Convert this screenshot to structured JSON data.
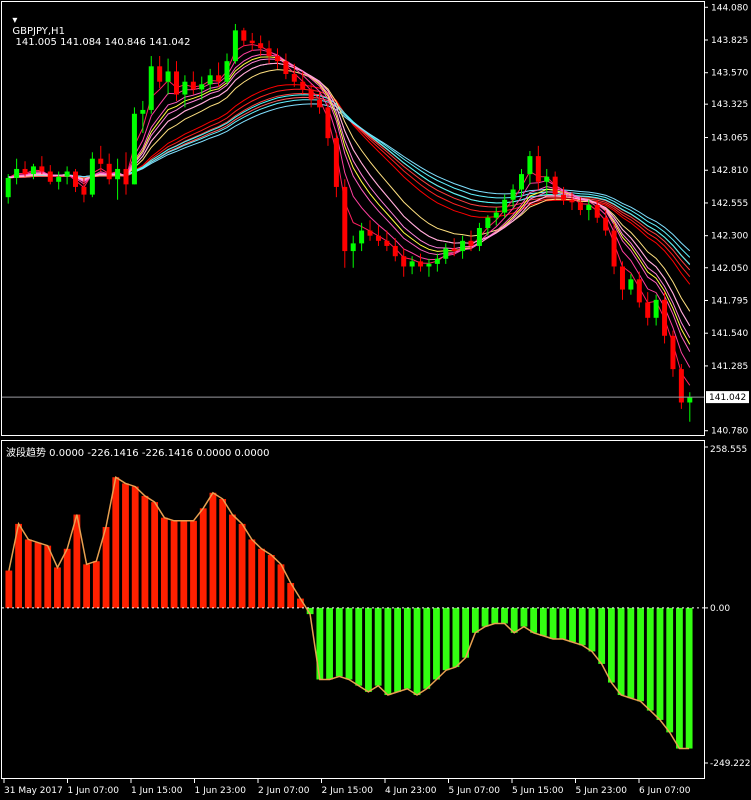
{
  "window": {
    "symbol_header": "GBPJPY,H1",
    "ohlc_values": [
      "141.005",
      "141.084",
      "140.846",
      "141.042"
    ],
    "indicator_header": "波段趋势 0.0000 -226.1416 -226.1416 0.0000 0.0000"
  },
  "colors": {
    "background": "#000000",
    "frame": "#ffffff",
    "bull_candle": "#00ff00",
    "bear_candle": "#ff0000",
    "hist_positive": "#ff2000",
    "hist_negative": "#33ff11",
    "hist_outline": "#e8a050",
    "ribbon_fast": [
      "#ff2060",
      "#ff40a0",
      "#ff60c0",
      "#ff80d8",
      "#ffa0e8"
    ],
    "ribbon_mid": [
      "#ffff40",
      "#ffef60",
      "#ffe080"
    ],
    "ribbon_slow_top": [
      "#40ffff",
      "#60f0ff",
      "#80e0ff"
    ],
    "ribbon_slow_bottom": [
      "#ff0000",
      "#ff2020",
      "#ff4040",
      "#ff6060"
    ]
  },
  "chart_data": [
    {
      "type": "candlestick",
      "title": "GBPJPY,H1",
      "price_axis_ticks": [
        "144.080",
        "143.825",
        "143.570",
        "143.325",
        "143.065",
        "142.810",
        "142.555",
        "142.300",
        "142.050",
        "141.795",
        "141.540",
        "141.285",
        "140.780"
      ],
      "current_price_label": "141.042",
      "ylim": [
        140.77,
        144.09
      ],
      "time_axis_labels": [
        "31 May 2017",
        "1 Jun 07:00",
        "1 Jun 15:00",
        "1 Jun 23:00",
        "2 Jun 07:00",
        "2 Jun 15:00",
        "4 Jun 23:00",
        "5 Jun 07:00",
        "5 Jun 15:00",
        "5 Jun 23:00",
        "6 Jun 07:00"
      ],
      "grid": false,
      "series": [
        {
          "values": [
            [
              142.6,
              142.78,
              142.55,
              142.75
            ],
            [
              142.75,
              142.9,
              142.7,
              142.82
            ],
            [
              142.82,
              142.88,
              142.76,
              142.78
            ],
            [
              142.78,
              142.86,
              142.74,
              142.84
            ],
            [
              142.84,
              142.92,
              142.78,
              142.8
            ],
            [
              142.8,
              142.85,
              142.7,
              142.72
            ],
            [
              142.72,
              142.8,
              142.66,
              142.76
            ],
            [
              142.76,
              142.84,
              142.7,
              142.8
            ],
            [
              142.8,
              142.82,
              142.64,
              142.68
            ],
            [
              142.68,
              142.75,
              142.56,
              142.62
            ],
            [
              142.62,
              142.95,
              142.6,
              142.9
            ],
            [
              142.9,
              143.0,
              142.8,
              142.86
            ],
            [
              142.86,
              142.94,
              142.7,
              142.74
            ],
            [
              142.74,
              142.9,
              142.58,
              142.82
            ],
            [
              142.82,
              142.95,
              142.62,
              142.7
            ],
            [
              142.7,
              143.3,
              142.7,
              143.25
            ],
            [
              143.25,
              143.35,
              143.1,
              143.28
            ],
            [
              143.28,
              143.7,
              143.25,
              143.62
            ],
            [
              143.62,
              143.7,
              143.45,
              143.5
            ],
            [
              143.5,
              143.68,
              143.4,
              143.58
            ],
            [
              143.58,
              143.66,
              143.35,
              143.4
            ],
            [
              143.4,
              143.55,
              143.3,
              143.5
            ],
            [
              143.5,
              143.58,
              143.4,
              143.44
            ],
            [
              143.44,
              143.54,
              143.36,
              143.48
            ],
            [
              143.48,
              143.6,
              143.42,
              143.55
            ],
            [
              143.55,
              143.65,
              143.46,
              143.5
            ],
            [
              143.5,
              143.72,
              143.48,
              143.66
            ],
            [
              143.66,
              143.95,
              143.64,
              143.9
            ],
            [
              143.9,
              143.92,
              143.78,
              143.82
            ],
            [
              143.82,
              143.88,
              143.74,
              143.8
            ],
            [
              143.8,
              143.86,
              143.7,
              143.76
            ],
            [
              143.76,
              143.82,
              143.64,
              143.7
            ],
            [
              143.7,
              143.76,
              143.6,
              143.66
            ],
            [
              143.66,
              143.72,
              143.52,
              143.56
            ],
            [
              143.56,
              143.64,
              143.46,
              143.5
            ],
            [
              143.5,
              143.58,
              143.4,
              143.44
            ],
            [
              143.44,
              143.48,
              143.3,
              143.36
            ],
            [
              143.36,
              143.42,
              143.25,
              143.3
            ],
            [
              143.3,
              143.34,
              143.0,
              143.06
            ],
            [
              143.06,
              143.1,
              142.6,
              142.68
            ],
            [
              142.68,
              142.74,
              142.05,
              142.18
            ],
            [
              142.18,
              142.3,
              142.05,
              142.24
            ],
            [
              142.24,
              142.4,
              142.18,
              142.34
            ],
            [
              142.34,
              142.42,
              142.26,
              142.3
            ],
            [
              142.3,
              142.38,
              142.22,
              142.26
            ],
            [
              142.26,
              142.34,
              142.18,
              142.22
            ],
            [
              142.22,
              142.28,
              142.1,
              142.14
            ],
            [
              142.14,
              142.2,
              141.98,
              142.06
            ],
            [
              142.06,
              142.14,
              142.0,
              142.1
            ],
            [
              142.1,
              142.16,
              142.02,
              142.06
            ],
            [
              142.06,
              142.12,
              141.98,
              142.08
            ],
            [
              142.08,
              142.16,
              142.02,
              142.12
            ],
            [
              142.12,
              142.24,
              142.08,
              142.2
            ],
            [
              142.2,
              142.28,
              142.14,
              142.18
            ],
            [
              142.18,
              142.3,
              142.12,
              142.26
            ],
            [
              142.26,
              142.34,
              142.18,
              142.22
            ],
            [
              142.22,
              142.4,
              142.18,
              142.36
            ],
            [
              142.36,
              142.46,
              142.3,
              142.44
            ],
            [
              142.44,
              142.52,
              142.38,
              142.48
            ],
            [
              142.48,
              142.62,
              142.44,
              142.58
            ],
            [
              142.58,
              142.7,
              142.52,
              142.66
            ],
            [
              142.66,
              142.82,
              142.6,
              142.78
            ],
            [
              142.78,
              142.96,
              142.7,
              142.92
            ],
            [
              142.92,
              143.0,
              142.66,
              142.72
            ],
            [
              142.72,
              142.82,
              142.62,
              142.76
            ],
            [
              142.76,
              142.8,
              142.58,
              142.62
            ],
            [
              142.62,
              142.68,
              142.54,
              142.58
            ],
            [
              142.58,
              142.64,
              142.5,
              142.56
            ],
            [
              142.56,
              142.6,
              142.46,
              142.5
            ],
            [
              142.5,
              142.58,
              142.42,
              142.54
            ],
            [
              142.54,
              142.58,
              142.4,
              142.44
            ],
            [
              142.44,
              142.5,
              142.3,
              142.34
            ],
            [
              142.34,
              142.4,
              142.0,
              142.06
            ],
            [
              142.06,
              142.1,
              141.8,
              141.88
            ],
            [
              141.88,
              142.0,
              141.84,
              141.96
            ],
            [
              141.96,
              142.02,
              141.74,
              141.78
            ],
            [
              141.78,
              141.86,
              141.6,
              141.66
            ],
            [
              141.66,
              141.84,
              141.6,
              141.8
            ],
            [
              141.8,
              141.86,
              141.46,
              141.52
            ],
            [
              141.52,
              141.56,
              141.2,
              141.26
            ],
            [
              141.26,
              141.3,
              140.95,
              141.0
            ],
            [
              141.0,
              141.08,
              140.85,
              141.04
            ]
          ]
        }
      ]
    },
    {
      "type": "bar",
      "title": "波段趋势",
      "yaxis_ticks": [
        "258.555",
        "0.00",
        "-249.2224"
      ],
      "ylim": [
        -249.2224,
        258.555
      ],
      "grid": false,
      "values": [
        60,
        135,
        110,
        105,
        100,
        65,
        95,
        150,
        70,
        75,
        130,
        210,
        200,
        195,
        180,
        170,
        145,
        140,
        140,
        140,
        160,
        185,
        175,
        150,
        135,
        110,
        95,
        85,
        70,
        40,
        15,
        -10,
        -115,
        -115,
        -110,
        -115,
        -125,
        -135,
        -125,
        -140,
        -135,
        -130,
        -140,
        -130,
        -115,
        -100,
        -95,
        -80,
        -40,
        -30,
        -25,
        -25,
        -40,
        -30,
        -40,
        -45,
        -50,
        -50,
        -55,
        -60,
        -70,
        -90,
        -120,
        -140,
        -145,
        -150,
        -165,
        -180,
        -200,
        -226,
        -226
      ]
    }
  ]
}
